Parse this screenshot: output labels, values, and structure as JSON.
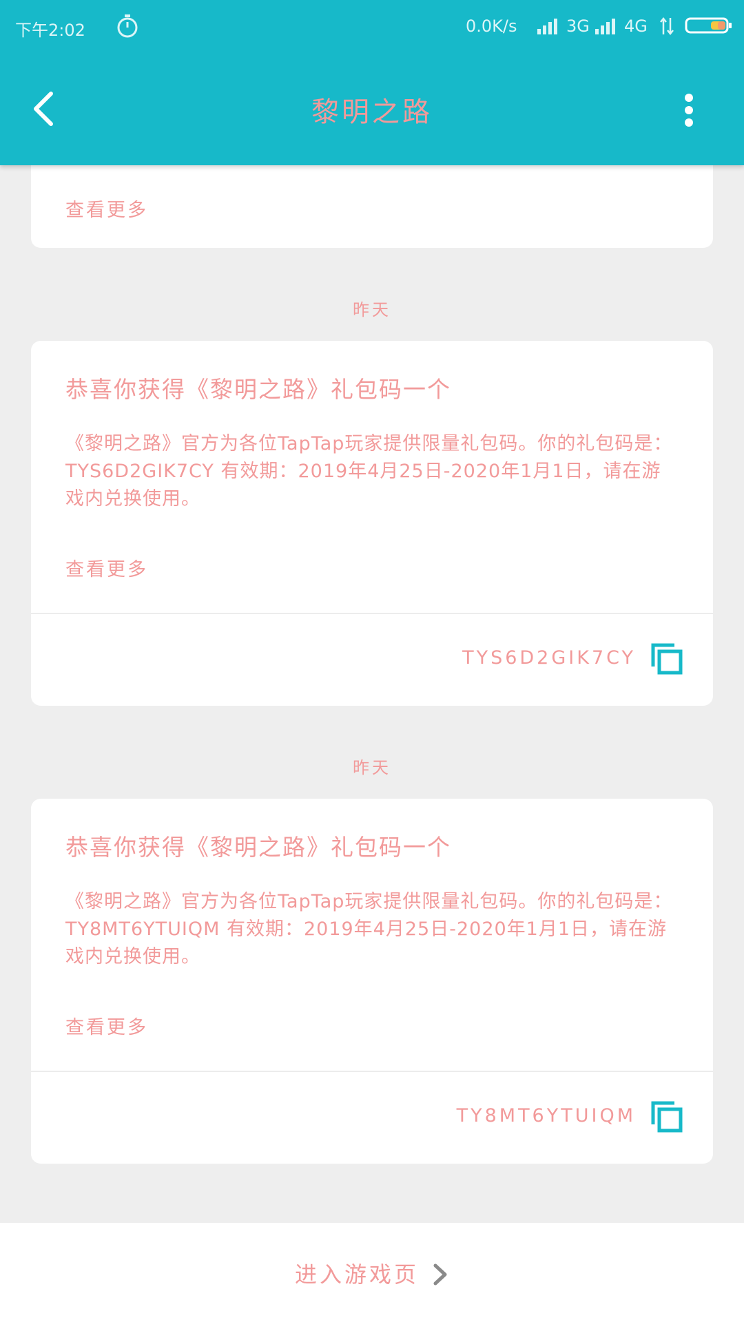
{
  "status_bar": {
    "time": "下午2:02",
    "net_speed": "0.0K/s",
    "network_3g": "3G",
    "network_4g": "4G"
  },
  "appbar": {
    "title": "黎明之路"
  },
  "partial_card": {
    "view_more": "查看更多"
  },
  "messages": [
    {
      "date": "昨天",
      "title": "恭喜你获得《黎明之路》礼包码一个",
      "body": "《黎明之路》官方为各位TapTap玩家提供限量礼包码。你的礼包码是：TYS6D2GIK7CY 有效期：2019年4月25日-2020年1月1日，请在游戏内兑换使用。",
      "view_more": "查看更多",
      "code": "TYS6D2GIK7CY"
    },
    {
      "date": "昨天",
      "title": "恭喜你获得《黎明之路》礼包码一个",
      "body": "《黎明之路》官方为各位TapTap玩家提供限量礼包码。你的礼包码是：TY8MT6YTUIQM 有效期：2019年4月25日-2020年1月1日，请在游戏内兑换使用。",
      "view_more": "查看更多",
      "code": "TY8MT6YTUIQM"
    }
  ],
  "bottom_bar": {
    "enter_game": "进入游戏页"
  },
  "colors": {
    "accent": "#17b9c9",
    "text_pink": "#f29a9a",
    "background": "#eeeeee",
    "card": "#ffffff"
  },
  "icons": {
    "back": "back-arrow-icon",
    "more": "more-vertical-icon",
    "copy": "copy-icon",
    "chevron": "chevron-right-icon",
    "stopwatch": "stopwatch-icon",
    "battery": "battery-icon"
  }
}
